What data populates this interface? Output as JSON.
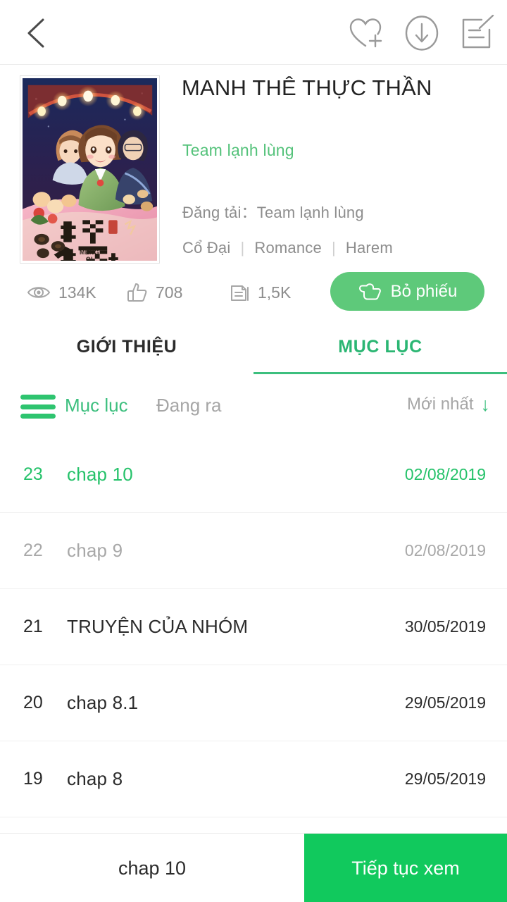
{
  "topbar": {
    "back_icon": "chevron-left-icon",
    "actions": [
      {
        "icon": "heart-plus-icon",
        "label": "Thêm vào yêu thích"
      },
      {
        "icon": "download-circle-icon",
        "label": "Tải xuống"
      },
      {
        "icon": "note-edit-icon",
        "label": "Bình luận"
      }
    ]
  },
  "comic": {
    "title": "MANH THÊ THỰC THẦN",
    "team": "Team lạnh lùng",
    "uploader_label": "Đăng tải",
    "uploader_sep": "：",
    "uploader_value": "Team lạnh lùng",
    "genres": [
      "Cổ Đại",
      "Romance",
      "Harem"
    ],
    "genre_separator": "|",
    "cover_alt": "Bìa truyện Manh Thê Thực Thần"
  },
  "stats": {
    "views": {
      "icon": "eye-icon",
      "value": "134K"
    },
    "likes": {
      "icon": "thumbs-up-icon",
      "value": "708"
    },
    "tickets": {
      "icon": "ticket-icon",
      "value": "1,5K"
    },
    "vote_button": {
      "icon": "hand-point-icon",
      "label": "Bỏ phiếu"
    }
  },
  "tabs": [
    {
      "label": "GIỚI THIỆU",
      "active": false
    },
    {
      "label": "MỤC LỤC",
      "active": true
    }
  ],
  "filters": {
    "menu_icon": "hamburger-icon",
    "index_label": "Mục lục",
    "status_label": "Đang ra",
    "sort_label": "Mới nhất",
    "sort_arrow": "↓"
  },
  "chapters": [
    {
      "num": "23",
      "name": "chap 10",
      "date": "02/08/2019",
      "state": "current"
    },
    {
      "num": "22",
      "name": "chap 9",
      "date": "02/08/2019",
      "state": "read"
    },
    {
      "num": "21",
      "name": "TRUYỆN CỦA NHÓM",
      "date": "30/05/2019",
      "state": "unread"
    },
    {
      "num": "20",
      "name": "chap 8.1",
      "date": "29/05/2019",
      "state": "unread"
    },
    {
      "num": "19",
      "name": "chap 8",
      "date": "29/05/2019",
      "state": "unread"
    }
  ],
  "bottombar": {
    "current_chapter": "chap 10",
    "continue_label": "Tiếp tục xem"
  },
  "colors": {
    "accent_green": "#3cbf7e",
    "vote_green": "#5ec97a",
    "continue_green": "#11c95d",
    "current_green": "#25c26a",
    "muted_gray": "#8d8d8d",
    "text_dark": "#2b2b2b"
  }
}
